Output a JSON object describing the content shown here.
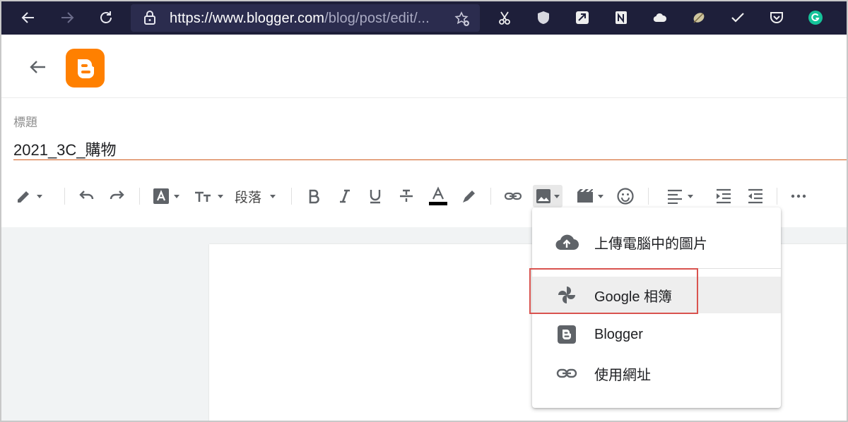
{
  "browser": {
    "url_main": "https://www.blogger.com",
    "url_rest": "/blog/post/edit/..."
  },
  "post": {
    "title_label": "標題",
    "title_value": "2021_3C_購物"
  },
  "toolbar": {
    "paragraph_label": "段落"
  },
  "image_menu": {
    "items": [
      {
        "label": "上傳電腦中的圖片",
        "icon": "cloud-upload-icon"
      },
      {
        "label": "Google 相簿",
        "icon": "google-photos-icon"
      },
      {
        "label": "Blogger",
        "icon": "blogger-icon"
      },
      {
        "label": "使用網址",
        "icon": "link-icon"
      }
    ]
  },
  "colors": {
    "browser_bar": "#1e1f3a",
    "blogger_orange": "#ff8000",
    "title_underline": "#d05a1c",
    "highlight_red": "#d9534f"
  }
}
